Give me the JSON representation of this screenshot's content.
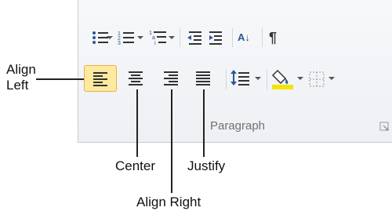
{
  "group": {
    "label": "Paragraph"
  },
  "callouts": {
    "align_left": {
      "line1": "Align",
      "line2": "Left"
    },
    "center": "Center",
    "justify": "Justify",
    "align_right": "Align Right"
  },
  "row1": {
    "sort_label": "A↓",
    "show_marks_label": "¶"
  },
  "colors": {
    "active_fill": "#fde9a0",
    "active_border": "#e8b24a",
    "highlight_yellow": "#f4e400",
    "icon_blue": "#2b5797",
    "icon_dark": "#333333"
  }
}
